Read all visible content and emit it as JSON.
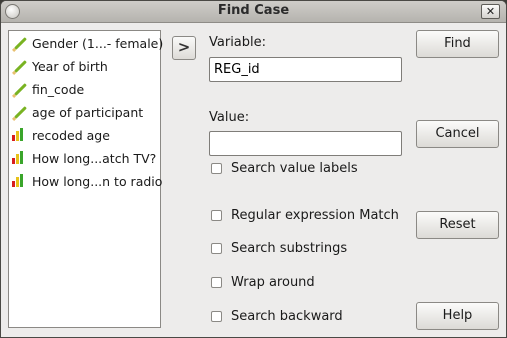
{
  "window": {
    "title": "Find Case"
  },
  "variables": [
    {
      "label": "Gender (1...- female)",
      "icon": "scale-icon"
    },
    {
      "label": "Year of birth",
      "icon": "scale-icon"
    },
    {
      "label": "fin_code",
      "icon": "scale-icon"
    },
    {
      "label": "age of participant",
      "icon": "scale-icon"
    },
    {
      "label": "recoded age",
      "icon": "ordinal-icon"
    },
    {
      "label": "How long...atch TV?",
      "icon": "ordinal-icon"
    },
    {
      "label": "How long...n to radio",
      "icon": "ordinal-icon"
    }
  ],
  "form": {
    "variable_label": "Variable:",
    "variable_value": "REG_id",
    "value_label": "Value:",
    "value_value": ""
  },
  "options": {
    "search_value_labels": "Search value labels",
    "regex": "Regular expression Match",
    "substrings": "Search substrings",
    "wrap": "Wrap around",
    "backward": "Search backward"
  },
  "buttons": {
    "find": "Find",
    "cancel": "Cancel",
    "reset": "Reset",
    "help": "Help",
    "transfer": ">"
  },
  "colors": {
    "scale": "#79b322",
    "ordinal_red": "#d81e1e",
    "ordinal_yellow": "#e8c21a",
    "ordinal_green": "#3aa52b"
  }
}
